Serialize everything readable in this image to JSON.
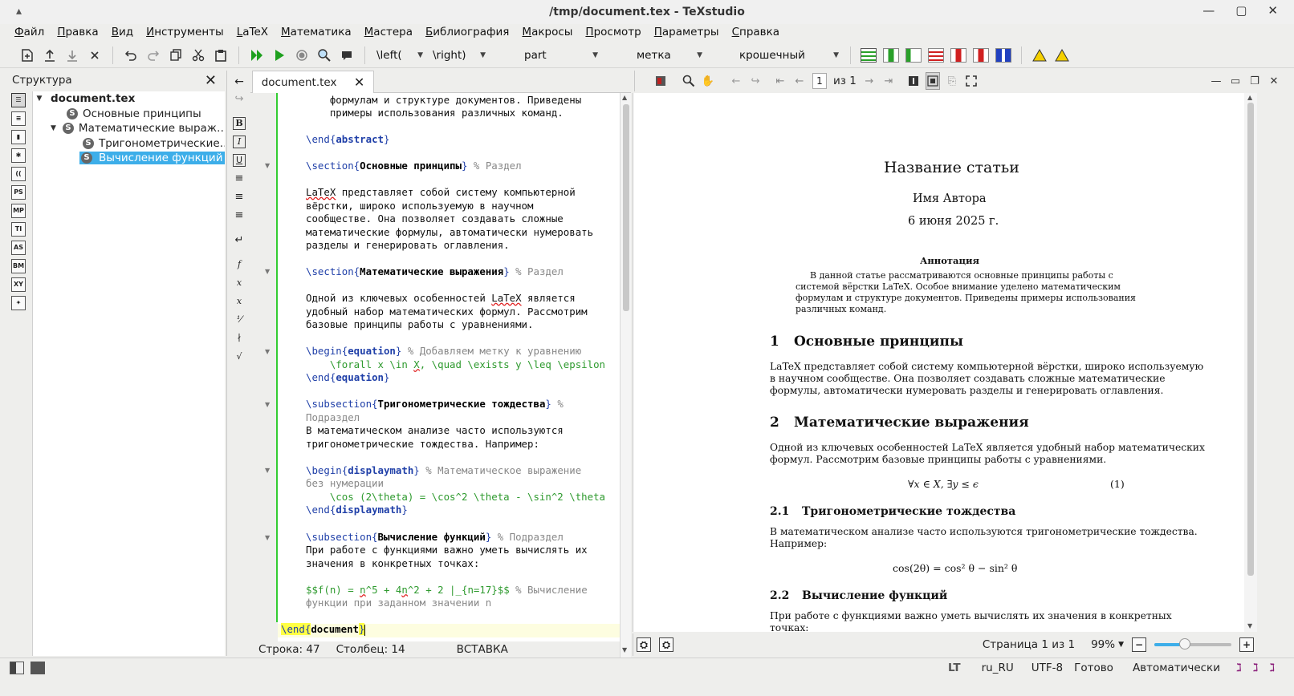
{
  "window": {
    "title": "/tmp/document.tex - TeXstudio",
    "controls": [
      "▴",
      "—",
      "▢",
      "✕"
    ]
  },
  "menu": [
    "Файл",
    "Правка",
    "Вид",
    "Инструменты",
    "LaTeX",
    "Математика",
    "Мастера",
    "Библиография",
    "Макросы",
    "Просмотр",
    "Параметры",
    "Справка"
  ],
  "toolbar": {
    "left_combo": "\\left(",
    "right_combo": "\\right)",
    "part_combo": "part",
    "label_combo": "метка",
    "size_combo": "крошечный"
  },
  "structure": {
    "title": "Структура",
    "side_labels": [
      "",
      "",
      "",
      "",
      "((",
      "PS",
      "MP",
      "TI",
      "AS",
      "BM",
      "XY",
      ""
    ],
    "tree": [
      {
        "label": "document.tex",
        "level": 0,
        "bold": true,
        "toggle": "▼"
      },
      {
        "label": "Основные принципы",
        "level": 1
      },
      {
        "label": "Математические выраж…",
        "level": 1,
        "toggle": "▼"
      },
      {
        "label": "Тригонометрические…",
        "level": 2
      },
      {
        "label": "Вычисление функций",
        "level": 2,
        "selected": true
      }
    ]
  },
  "editor": {
    "tab_label": "document.tex",
    "status": {
      "line": "Строка: 47",
      "column": "Столбец: 14",
      "mode": "ВСТАВКА"
    }
  },
  "pdf": {
    "page_input": "1",
    "page_of": "из 1",
    "doc_title": "Название статьи",
    "author": "Имя Автора",
    "date": "6 июня 2025 г.",
    "abstract_heading": "Аннотация",
    "abstract_lines": [
      "В данной статье рассматриваются основные принципы работы с",
      "системой вёрстки LaTeX. Особое внимание уделено математическим",
      "формулам и структуре документов. Приведены примеры использования",
      "различных команд."
    ],
    "sec1_num": "1",
    "sec1_title": "Основные принципы",
    "sec1_lines": [
      "LaTeX представляет собой систему компьютерной вёрстки, широко используемую",
      "в научном сообществе. Она позволяет создавать сложные математические",
      "формулы, автоматически нумеровать разделы и генерировать оглавления."
    ],
    "sec2_num": "2",
    "sec2_title": "Математические выражения",
    "sec2_lines": [
      "Одной из ключевых особенностей LaTeX является удобный набор математических",
      "формул. Рассмотрим базовые принципы работы с уравнениями."
    ],
    "eq1": "∀x ∈ X,    ∃y ≤ ϵ",
    "eq1_num": "(1)",
    "sub1_num": "2.1",
    "sub1_title": "Тригонометрические тождества",
    "sub1_lines": [
      "В математическом анализе часто используются тригонометрические тождества.",
      "Например:"
    ],
    "eq2": "cos(2θ) = cos² θ − sin² θ",
    "sub2_num": "2.2",
    "sub2_title": "Вычисление функций",
    "sub2_lines": [
      "При работе с функциями важно уметь вычислять их значения в конкретных",
      "точках:"
    ],
    "status_page": "Страница 1 из 1",
    "zoom": "99%",
    "zoom_level_percent": 40
  },
  "bottom": {
    "lang": "ru_RU",
    "encoding": "UTF-8",
    "ready": "Готово",
    "auto": "Автоматически"
  },
  "colors": {
    "selection": "#3daee9",
    "keyword": "#1f3fa8",
    "math_green": "#2e9a2e",
    "comment": "#888888",
    "change_bar": "#33cc33"
  }
}
